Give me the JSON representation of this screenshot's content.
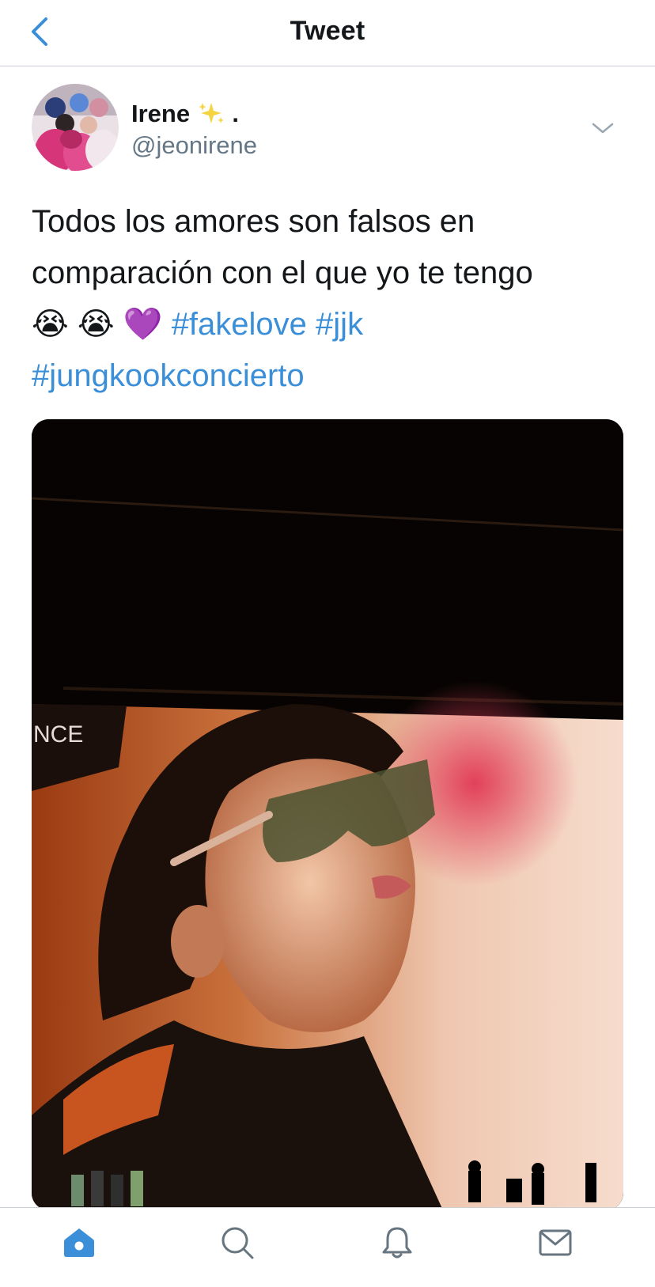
{
  "navbar": {
    "title": "Tweet",
    "back_icon": "chevron-left-icon"
  },
  "author": {
    "display_name": "Irene",
    "name_suffix": " .",
    "sparkle_icon": "sparkles-icon",
    "handle": "@jeonirene",
    "avatar_icon": "group-photo-avatar"
  },
  "tweet": {
    "line1": "Todos los amores son falsos en",
    "line2": "comparación con el que yo te tengo",
    "emoji_1": "😭",
    "emoji_2": "😭",
    "emoji_3": "💜",
    "hashtag_1": "#fakelove",
    "hashtag_2": "#jjk",
    "hashtag_3": "#jungkookconcierto"
  },
  "media": {
    "screen_text": "NCE"
  },
  "tabbar": {
    "items": [
      {
        "icon": "home-icon",
        "active": true
      },
      {
        "icon": "search-icon",
        "active": false
      },
      {
        "icon": "bell-icon",
        "active": false
      },
      {
        "icon": "mail-icon",
        "active": false
      }
    ]
  },
  "colors": {
    "accent": "#3b8fd8",
    "text": "#14171a",
    "secondary": "#657786",
    "divider": "#c9cfd4",
    "icon_gray": "#66757f"
  }
}
